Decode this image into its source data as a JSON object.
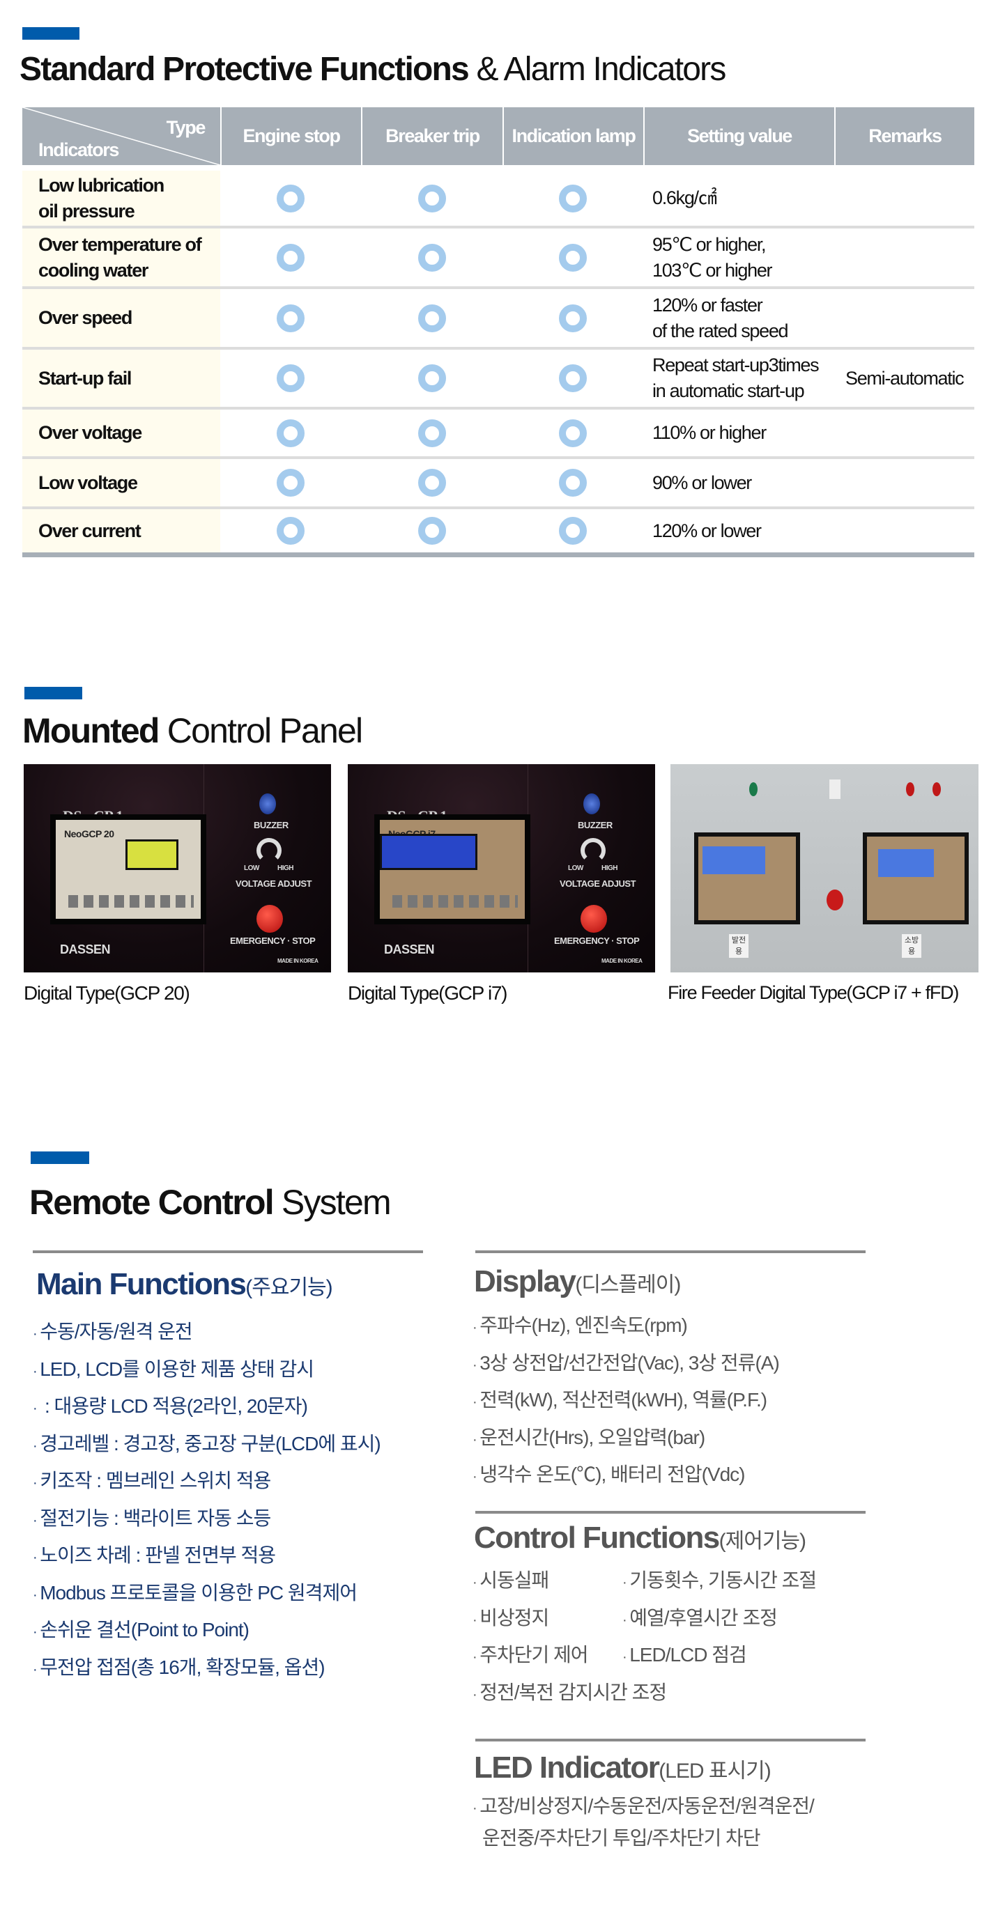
{
  "section1": {
    "title_bold": "Standard Protective Functions",
    "title_light": " & Alarm Indicators",
    "table": {
      "corner_type": "Type",
      "corner_indicators": "Indicators",
      "columns": [
        "Engine stop",
        "Breaker trip",
        "Indication lamp",
        "Setting value",
        "Remarks"
      ],
      "mark_symbol": "circle",
      "rows": [
        {
          "indicator": "Low lubrication\noil pressure",
          "engine_stop": true,
          "breaker_trip": true,
          "indication_lamp": true,
          "setting": "0.6kg/㎠",
          "remarks": ""
        },
        {
          "indicator": "Over temperature of\ncooling water",
          "engine_stop": true,
          "breaker_trip": true,
          "indication_lamp": true,
          "setting": "95℃ or higher,\n103℃ or higher",
          "remarks": ""
        },
        {
          "indicator": "Over speed",
          "engine_stop": true,
          "breaker_trip": true,
          "indication_lamp": true,
          "setting": "120% or faster\nof the rated speed",
          "remarks": ""
        },
        {
          "indicator": "Start-up fail",
          "engine_stop": true,
          "breaker_trip": true,
          "indication_lamp": true,
          "setting": "Repeat start-up3times\nin automatic start-up",
          "remarks": "Semi-automatic"
        },
        {
          "indicator": "Over voltage",
          "engine_stop": true,
          "breaker_trip": true,
          "indication_lamp": true,
          "setting": "110% or higher",
          "remarks": ""
        },
        {
          "indicator": "Low voltage",
          "engine_stop": true,
          "breaker_trip": true,
          "indication_lamp": true,
          "setting": "90% or lower",
          "remarks": ""
        },
        {
          "indicator": "Over current",
          "engine_stop": true,
          "breaker_trip": true,
          "indication_lamp": true,
          "setting": "120% or lower",
          "remarks": ""
        }
      ]
    }
  },
  "section2": {
    "title_bold": "Mounted",
    "title_light": " Control Panel",
    "photos": [
      {
        "caption": "Digital Type(GCP 20)",
        "model": "DS - CP 1",
        "controller": "NeoGCP 20",
        "buzzer": "BUZZER",
        "voltage": "VOLTAGE ADJUST",
        "low": "LOW",
        "high": "HIGH",
        "estop": "EMERGENCY · STOP",
        "brand": "DASSEN",
        "made": "MADE IN KOREA"
      },
      {
        "caption": "Digital Type(GCP i7)",
        "model": "DS - CP 1",
        "controller": "NeoGCP i7",
        "buzzer": "BUZZER",
        "voltage": "VOLTAGE ADJUST",
        "low": "LOW",
        "high": "HIGH",
        "estop": "EMERGENCY · STOP",
        "brand": "DASSEN",
        "made": "MADE IN KOREA"
      },
      {
        "caption": "Fire Feeder Digital Type(GCP i7 + fFD)",
        "label_left": "발전용",
        "label_right": "소방용"
      }
    ]
  },
  "section3": {
    "title_bold": "Remote Control",
    "title_light": " System",
    "main": {
      "title": "Main Functions",
      "title_ko": "(주요기능)",
      "items": [
        "수동/자동/원격 운전",
        "LED, LCD를 이용한 제품 상태 감시",
        " : 대용량 LCD 적용(2라인, 20문자)",
        "경고레벨 : 경고장, 중고장 구분(LCD에 표시)",
        "키조작 : 멤브레인 스위치 적용",
        "절전기능 : 백라이트 자동 소등",
        "노이즈 차례 : 판넬 전면부 적용",
        "Modbus 프로토콜을 이용한 PC 원격제어",
        "손쉬운 결선(Point to Point)",
        "무전압 접점(총 16개, 확장모듈, 옵션)"
      ]
    },
    "display": {
      "title": "Display",
      "title_ko": "(디스플레이)",
      "items": [
        "주파수(Hz), 엔진속도(rpm)",
        "3상 상전압/선간전압(Vac), 3상 전류(A)",
        "전력(kW), 적산전력(kWH), 역률(P.F.)",
        "운전시간(Hrs), 오일압력(bar)",
        "냉각수 온도(℃), 배터리 전압(Vdc)"
      ]
    },
    "control": {
      "title": "Control Functions",
      "title_ko": "(제어기능)",
      "col1": [
        "시동실패",
        "비상정지",
        "주차단기 제어",
        "정전/복전 감지시간 조정"
      ],
      "col2": [
        "기동횟수, 기동시간 조절",
        "예열/후열시간 조정",
        "LED/LCD 점검"
      ]
    },
    "led": {
      "title": "LED Indicator",
      "title_ko": "(LED  표시기)",
      "line1": "고장/비상정지/수동운전/자동운전/원격운전/",
      "line2": "운전중/주차단기 투입/주차단기 차단"
    }
  },
  "colors": {
    "accent_blue": "#005bab",
    "header_gray": "#a7afb7",
    "mark_blue": "#a4cbed",
    "indicator_bg": "#fffcee",
    "navy_text": "#1b3a70"
  }
}
